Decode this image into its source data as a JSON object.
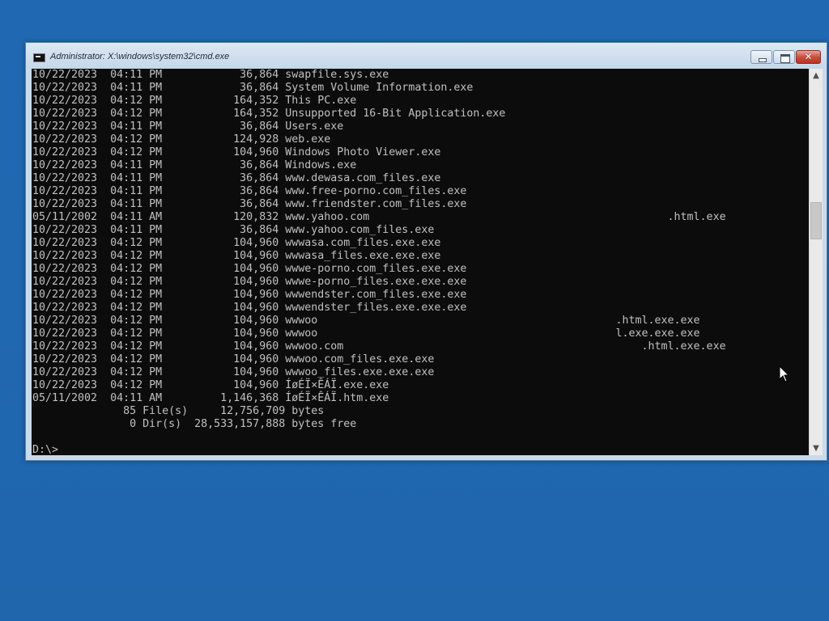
{
  "window": {
    "title": "Administrator: X:\\windows\\system32\\cmd.exe",
    "icon": "cmd-icon"
  },
  "caption_buttons": {
    "minimize": "minimize-icon",
    "maximize": "maximize-icon",
    "close": "close-icon",
    "close_glyph": "✕"
  },
  "scrollbar": {
    "up_arrow": "▲",
    "down_arrow": "▼"
  },
  "console": {
    "lines": [
      "10/22/2023  04:11 PM            36,864 swapfile.sys.exe",
      "10/22/2023  04:11 PM            36,864 System Volume Information.exe",
      "10/22/2023  04:12 PM           164,352 This PC.exe",
      "10/22/2023  04:12 PM           164,352 Unsupported 16-Bit Application.exe",
      "10/22/2023  04:11 PM            36,864 Users.exe",
      "10/22/2023  04:12 PM           124,928 web.exe",
      "10/22/2023  04:12 PM           104,960 Windows Photo Viewer.exe",
      "10/22/2023  04:11 PM            36,864 Windows.exe",
      "10/22/2023  04:11 PM            36,864 www.dewasa.com_files.exe",
      "10/22/2023  04:11 PM            36,864 www.free-porno.com_files.exe",
      "10/22/2023  04:11 PM            36,864 www.friendster.com_files.exe",
      "05/11/2002  04:11 AM           120,832 www.yahoo.com                                              .html.exe",
      "10/22/2023  04:11 PM            36,864 www.yahoo.com_files.exe",
      "10/22/2023  04:12 PM           104,960 wwwasa.com_files.exe.exe",
      "10/22/2023  04:12 PM           104,960 wwwasa_files.exe.exe.exe",
      "10/22/2023  04:12 PM           104,960 wwwe-porno.com_files.exe.exe",
      "10/22/2023  04:12 PM           104,960 wwwe-porno_files.exe.exe.exe",
      "10/22/2023  04:12 PM           104,960 wwwendster.com_files.exe.exe",
      "10/22/2023  04:12 PM           104,960 wwwendster_files.exe.exe.exe",
      "10/22/2023  04:12 PM           104,960 wwwoo                                              .html.exe.exe",
      "10/22/2023  04:12 PM           104,960 wwwoo                                              l.exe.exe.exe",
      "10/22/2023  04:12 PM           104,960 wwwoo.com                                              .html.exe.exe",
      "10/22/2023  04:12 PM           104,960 wwwoo.com_files.exe.exe",
      "10/22/2023  04:12 PM           104,960 wwwoo_files.exe.exe.exe",
      "10/22/2023  04:12 PM           104,960 ÍøÉÏ×ÊÁÏ.exe.exe",
      "05/11/2002  04:11 AM         1,146,368 ÍøÉÏ×ÊÁÏ.htm.exe",
      "              85 File(s)     12,756,709 bytes",
      "               0 Dir(s)  28,533,157,888 bytes free",
      "",
      "D:\\>"
    ]
  },
  "cursor": "mouse-pointer-icon"
}
